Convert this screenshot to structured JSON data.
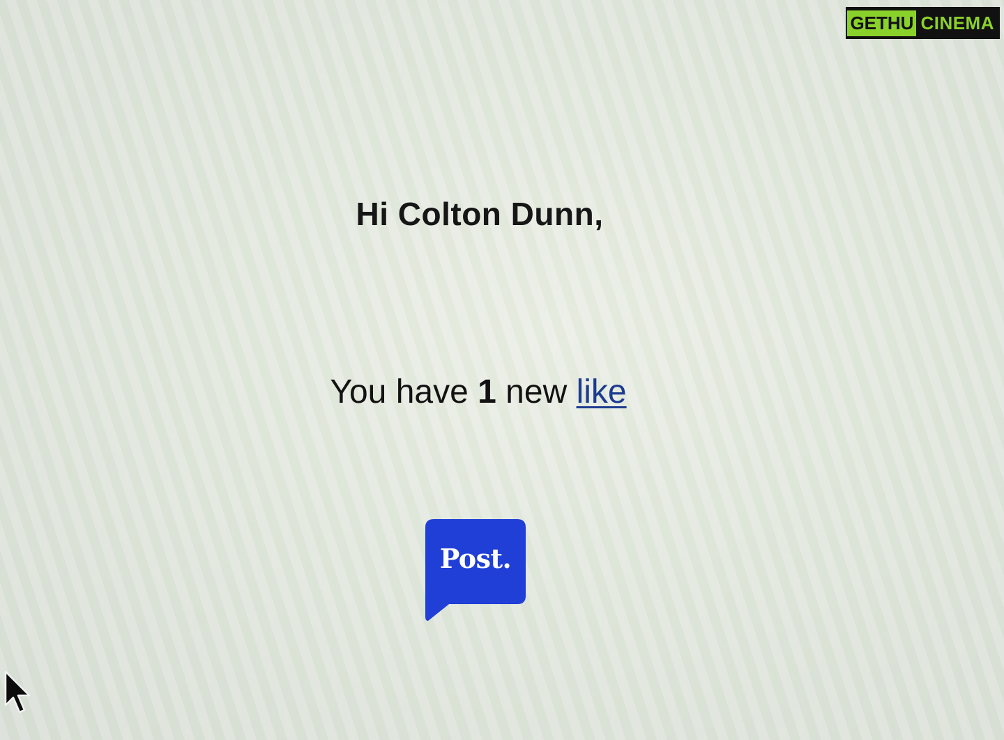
{
  "email": {
    "greeting": "Hi Colton Dunn,",
    "message_prefix": "You have ",
    "like_count": "1",
    "message_middle": " new ",
    "like_link_label": "like"
  },
  "logo": {
    "text": "Post.",
    "color": "#1f3fd6"
  },
  "watermark": {
    "part1": "GETHU",
    "part2": "CINEMA",
    "accent_color": "#8bd12c"
  },
  "icons": {
    "cursor": "mouse-pointer-icon",
    "logo": "speech-bubble-icon"
  }
}
